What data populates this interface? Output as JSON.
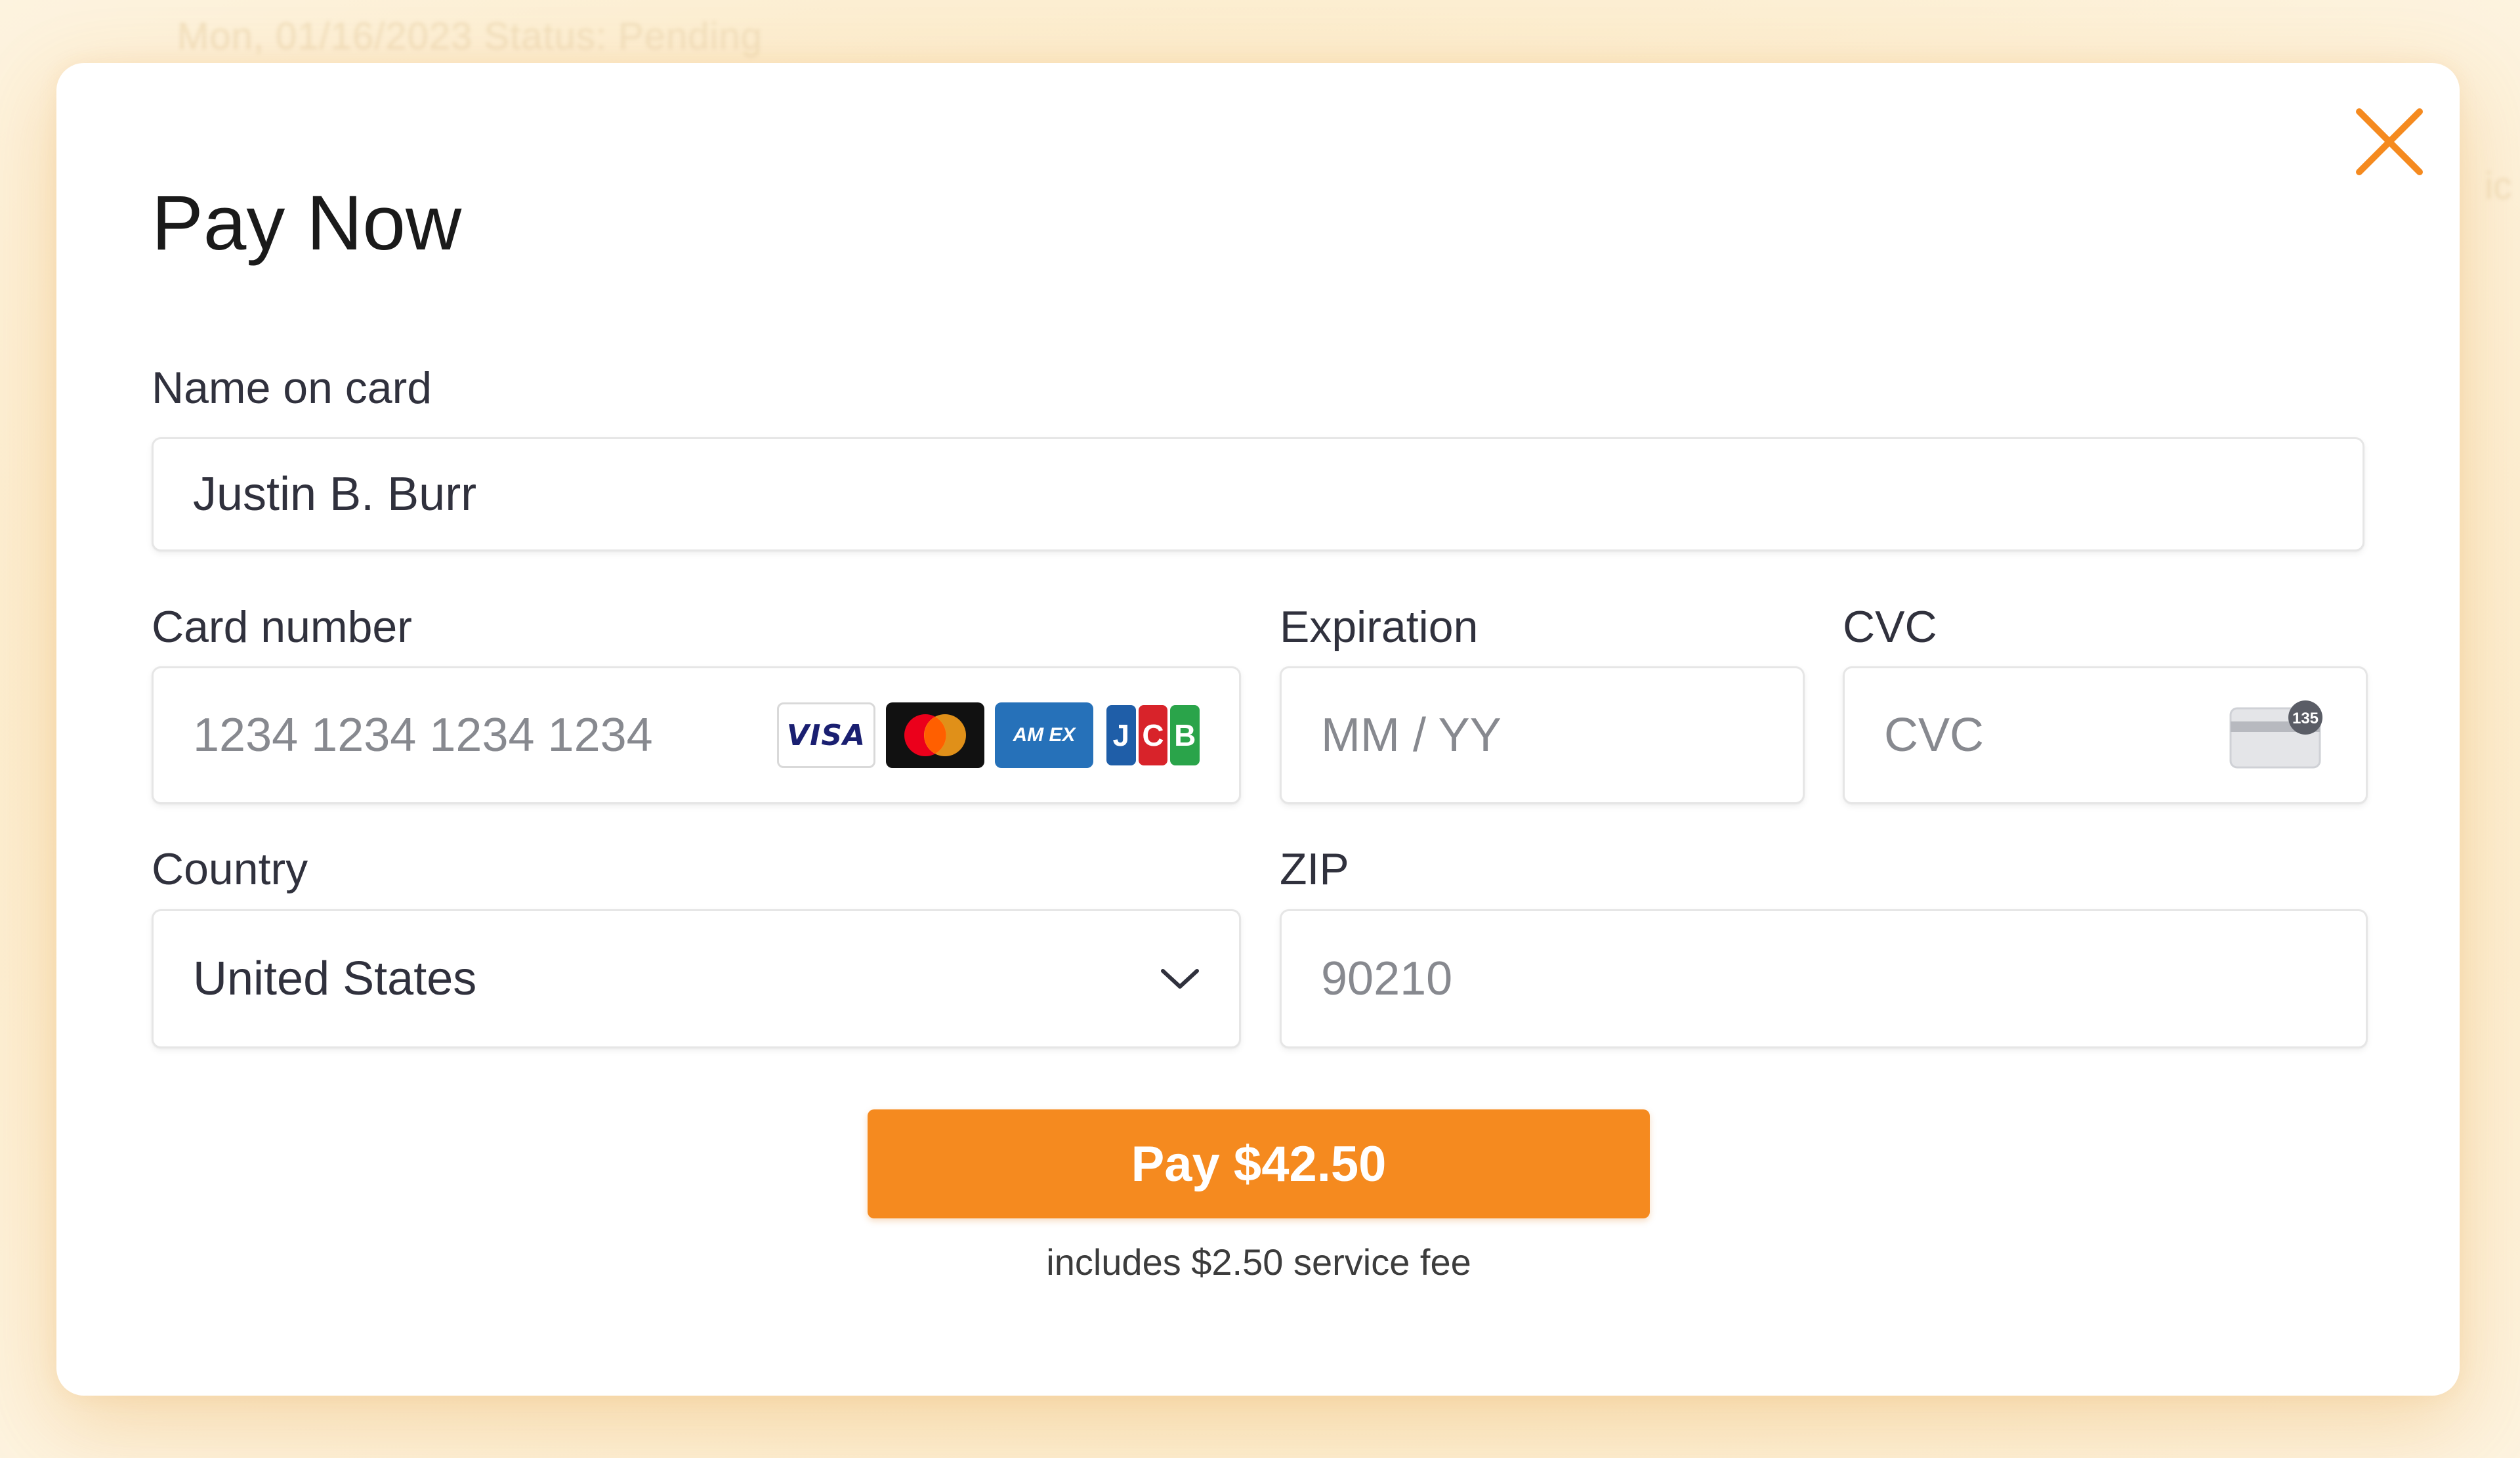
{
  "background": {
    "text_top": "Mon, 01/16/2023 Status: Pending",
    "text_right": "ic"
  },
  "modal": {
    "title": "Pay Now",
    "close_icon": "close-icon",
    "accent_color": "#f58a1f"
  },
  "form": {
    "name": {
      "label": "Name on card",
      "value": "Justin B. Burr"
    },
    "card_number": {
      "label": "Card number",
      "placeholder": "1234 1234 1234 1234",
      "brands": [
        "VISA",
        "Mastercard",
        "AMEX",
        "JCB"
      ],
      "visa_text": "VISA",
      "amex_text": "AM EX",
      "jcb_letters": [
        "J",
        "C",
        "B"
      ]
    },
    "expiration": {
      "label": "Expiration",
      "placeholder": "MM / YY"
    },
    "cvc": {
      "label": "CVC",
      "placeholder": "CVC",
      "icon_badge": "135"
    },
    "country": {
      "label": "Country",
      "value": "United States"
    },
    "zip": {
      "label": "ZIP",
      "placeholder": "90210"
    }
  },
  "pay_button": {
    "label": "Pay $42.50"
  },
  "fee_note": "includes $2.50 service fee"
}
